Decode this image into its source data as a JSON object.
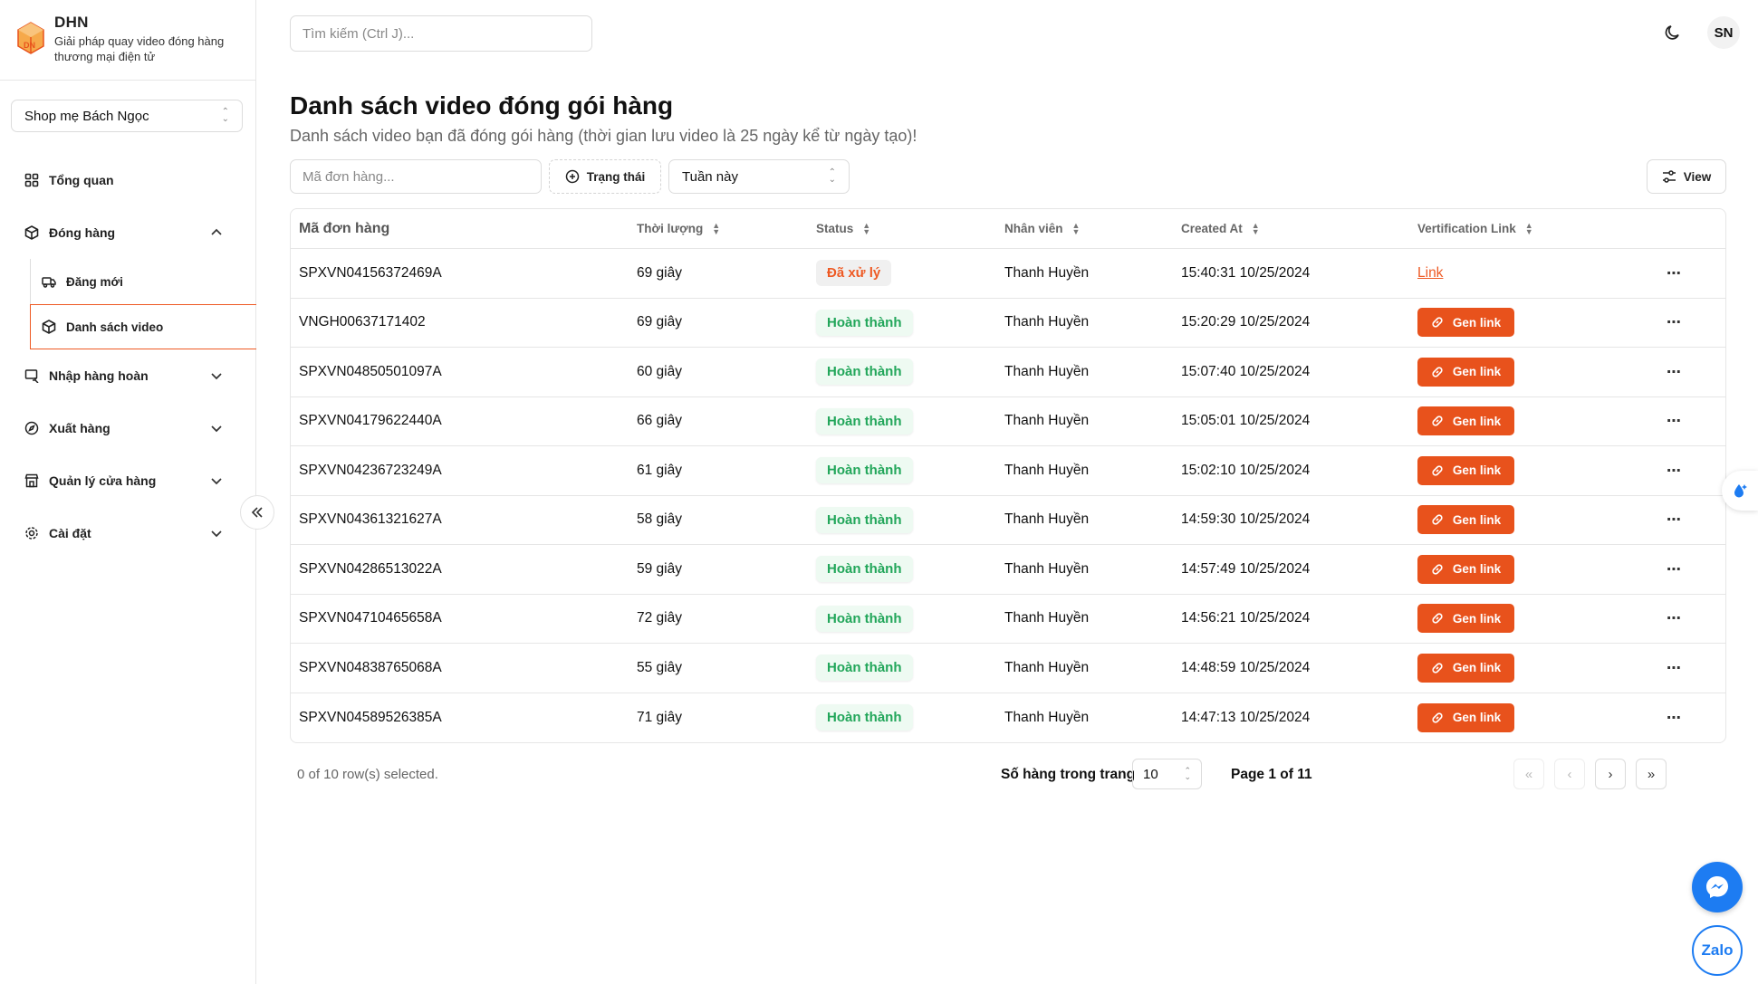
{
  "brand": {
    "name": "DHN",
    "tagline": "Giải pháp quay video đóng hàng thương mại điện tử"
  },
  "shop_select": {
    "value": "Shop mẹ Bách Ngọc"
  },
  "nav": {
    "overview": "Tổng quan",
    "packing": "Đóng hàng",
    "packing_sub": {
      "new": "Đăng mới",
      "video_list": "Danh sách video"
    },
    "returns": "Nhập hàng hoàn",
    "export": "Xuất hàng",
    "store_mgmt": "Quản lý cửa hàng",
    "settings": "Cài đặt"
  },
  "search": {
    "placeholder": "Tìm kiếm (Ctrl J)..."
  },
  "user": {
    "initials": "SN"
  },
  "page": {
    "title": "Danh sách video đóng gói hàng",
    "subtitle": "Danh sách video bạn đã đóng gói hàng (thời gian lưu video là 25 ngày kể từ ngày tạo)!"
  },
  "filters": {
    "order_placeholder": "Mã đơn hàng...",
    "status_label": "Trạng thái",
    "period_value": "Tuần này",
    "view_label": "View"
  },
  "table": {
    "headers": {
      "order": "Mã đơn hàng",
      "duration": "Thời lượng",
      "status": "Status",
      "staff": "Nhân viên",
      "created": "Created At",
      "link": "Vertification Link"
    },
    "rows": [
      {
        "order": "SPXVN04156372469A",
        "duration": "69 giây",
        "status": "Đã xử lý",
        "staff": "Thanh Huyền",
        "created": "15:40:31 10/25/2024",
        "link": "Link"
      },
      {
        "order": "VNGH00637171402",
        "duration": "69 giây",
        "status": "Hoàn thành",
        "staff": "Thanh Huyền",
        "created": "15:20:29 10/25/2024",
        "link": "Gen link"
      },
      {
        "order": "SPXVN04850501097A",
        "duration": "60 giây",
        "status": "Hoàn thành",
        "staff": "Thanh Huyền",
        "created": "15:07:40 10/25/2024",
        "link": "Gen link"
      },
      {
        "order": "SPXVN04179622440A",
        "duration": "66 giây",
        "status": "Hoàn thành",
        "staff": "Thanh Huyền",
        "created": "15:05:01 10/25/2024",
        "link": "Gen link"
      },
      {
        "order": "SPXVN04236723249A",
        "duration": "61 giây",
        "status": "Hoàn thành",
        "staff": "Thanh Huyền",
        "created": "15:02:10 10/25/2024",
        "link": "Gen link"
      },
      {
        "order": "SPXVN04361321627A",
        "duration": "58 giây",
        "status": "Hoàn thành",
        "staff": "Thanh Huyền",
        "created": "14:59:30 10/25/2024",
        "link": "Gen link"
      },
      {
        "order": "SPXVN04286513022A",
        "duration": "59 giây",
        "status": "Hoàn thành",
        "staff": "Thanh Huyền",
        "created": "14:57:49 10/25/2024",
        "link": "Gen link"
      },
      {
        "order": "SPXVN04710465658A",
        "duration": "72 giây",
        "status": "Hoàn thành",
        "staff": "Thanh Huyền",
        "created": "14:56:21 10/25/2024",
        "link": "Gen link"
      },
      {
        "order": "SPXVN04838765068A",
        "duration": "55 giây",
        "status": "Hoàn thành",
        "staff": "Thanh Huyền",
        "created": "14:48:59 10/25/2024",
        "link": "Gen link"
      },
      {
        "order": "SPXVN04589526385A",
        "duration": "71 giây",
        "status": "Hoàn thành",
        "staff": "Thanh Huyền",
        "created": "14:47:13 10/25/2024",
        "link": "Gen link"
      }
    ]
  },
  "footer": {
    "selected": "0 of 10 row(s) selected.",
    "rows_per_page_label": "Số hàng trong trang",
    "rows_per_page_value": "10",
    "page_info": "Page 1 of 11"
  },
  "widgets": {
    "zalo": "Zalo"
  },
  "colors": {
    "accent": "#e8521c",
    "success": "#22a65a",
    "messenger": "#1d7cf2"
  }
}
